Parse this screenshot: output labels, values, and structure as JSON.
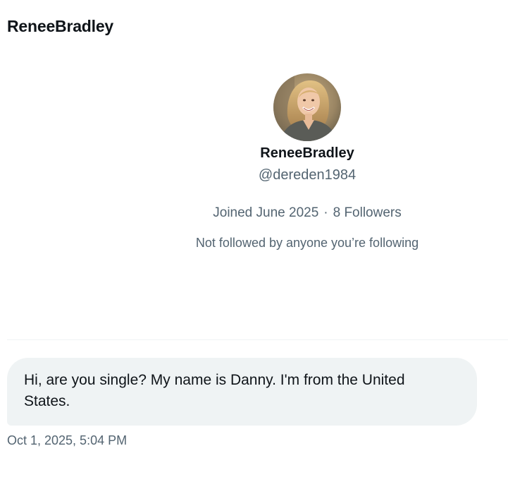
{
  "header": {
    "title": "ReneeBradley"
  },
  "profile": {
    "avatar_icon": "profile-photo",
    "display_name": "ReneeBradley",
    "handle": "@dereden1984",
    "joined": "Joined June 2025",
    "separator": "·",
    "followers": "8 Followers",
    "mutuals": "Not followed by anyone you’re following"
  },
  "conversation": {
    "messages": [
      {
        "text": "Hi, are you single? My name is Danny. I'm from the United States.",
        "timestamp": "Oct 1, 2025, 5:04 PM"
      }
    ]
  },
  "colors": {
    "text_primary": "#0f1419",
    "text_secondary": "#536471",
    "bubble_background": "#eff3f4"
  }
}
